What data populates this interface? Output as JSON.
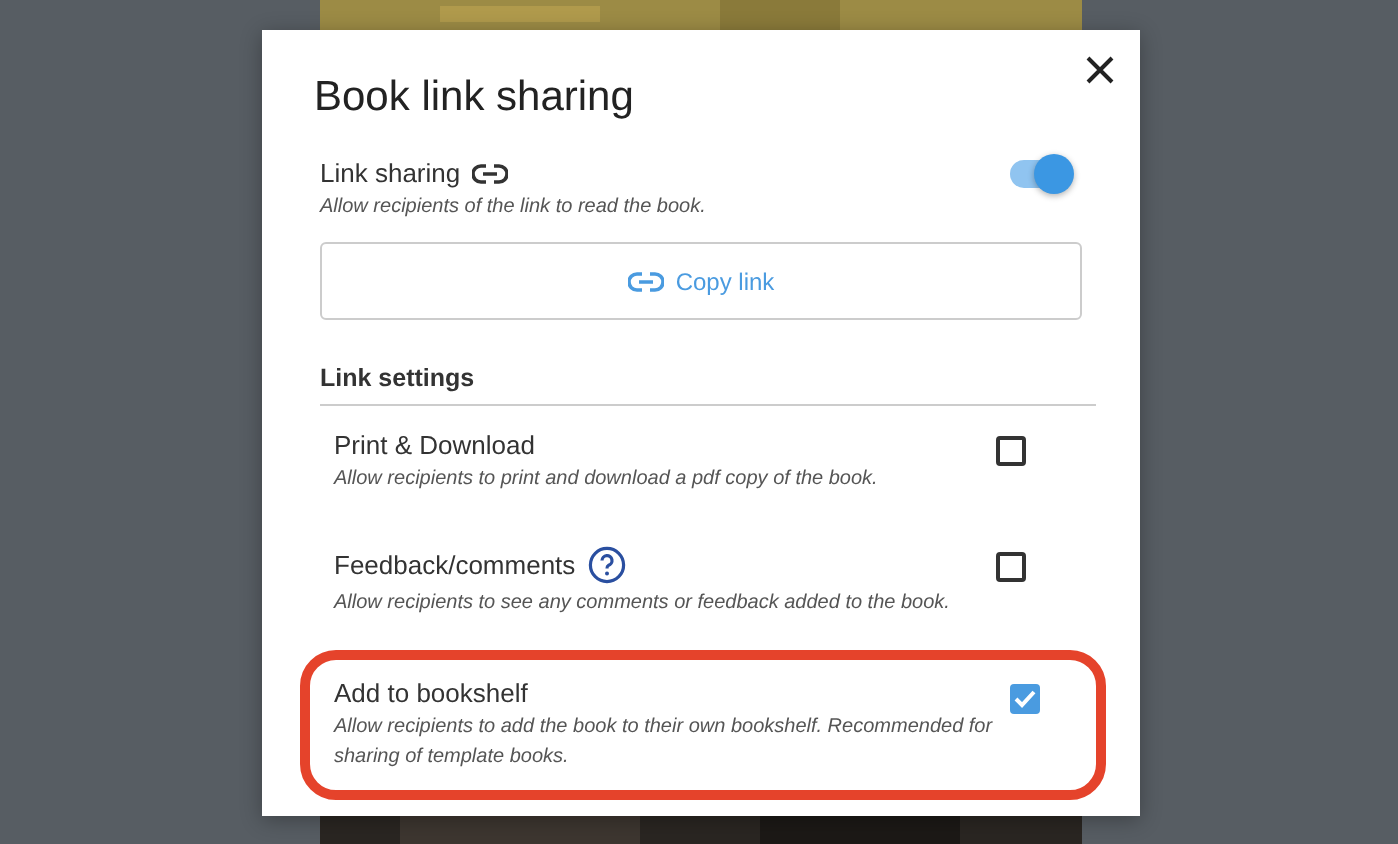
{
  "dialog": {
    "title": "Book link sharing",
    "link_sharing": {
      "label": "Link sharing",
      "description": "Allow recipients of the link to read the book.",
      "on": true
    },
    "copy_button": {
      "label": "Copy link"
    },
    "section_title": "Link settings",
    "options": [
      {
        "label": "Print & Download",
        "description": "Allow recipients to print and download a pdf copy of the book.",
        "checked": false,
        "help": false,
        "highlighted": false
      },
      {
        "label": "Feedback/comments",
        "description": "Allow recipients to see any comments or feedback added to the book.",
        "checked": false,
        "help": true,
        "highlighted": false
      },
      {
        "label": "Add to bookshelf",
        "description": "Allow recipients to add the book to their own bookshelf. Recommended for sharing of template books.",
        "checked": true,
        "help": false,
        "highlighted": true
      }
    ]
  }
}
